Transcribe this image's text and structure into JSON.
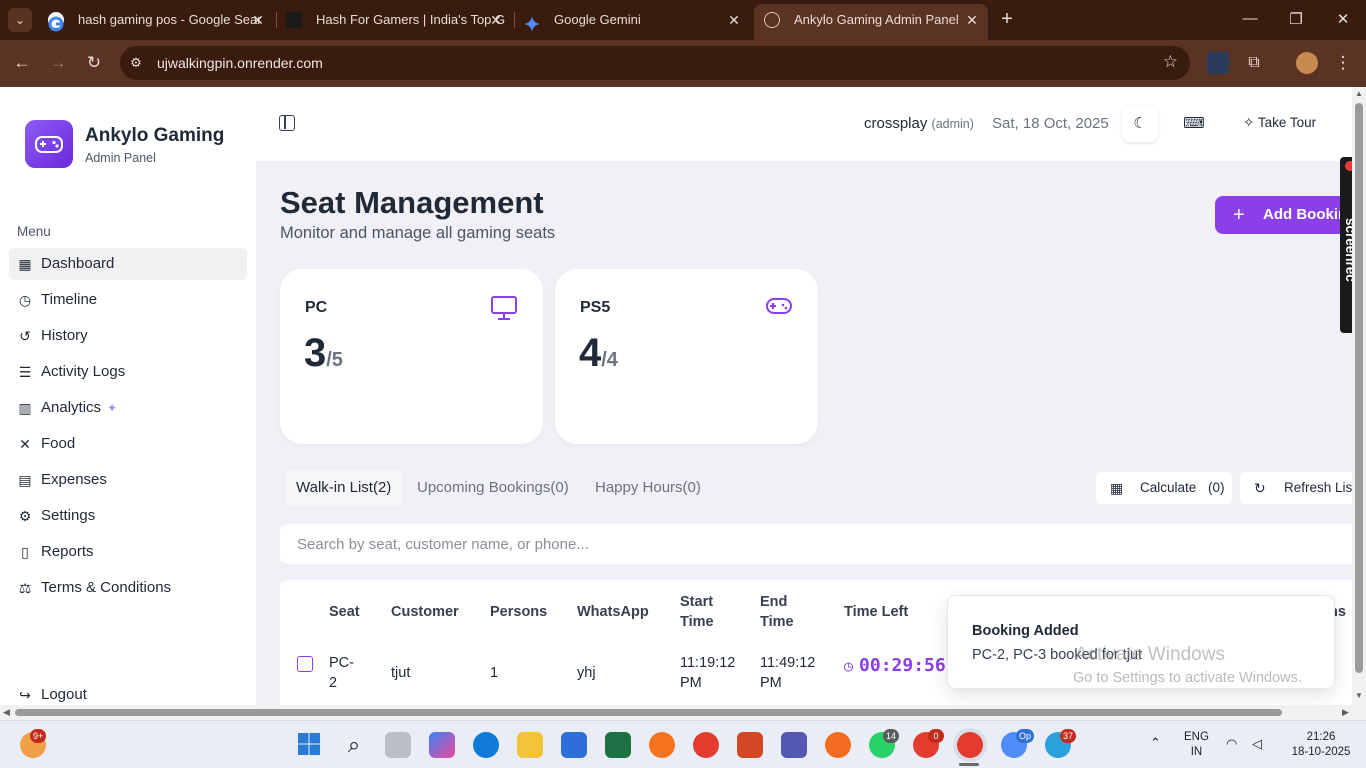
{
  "browser": {
    "tabs": [
      {
        "title": "hash gaming pos - Google Sear",
        "favicon_color": "#ffffff"
      },
      {
        "title": "Hash For Gamers | India's Top G",
        "favicon_color": "#1a1a1a"
      },
      {
        "title": "Google Gemini",
        "favicon_color": "#4f8cf7"
      },
      {
        "title": "Ankylo Gaming Admin Panel",
        "favicon_color": "#cfc4bd"
      }
    ],
    "url": "ujwalkingpin.onrender.com"
  },
  "sidebar": {
    "brand": "Ankylo Gaming",
    "brand_sub": "Admin Panel",
    "menu_title": "Menu",
    "items": [
      {
        "label": "Dashboard",
        "icon": "grid-icon"
      },
      {
        "label": "Timeline",
        "icon": "clock-icon"
      },
      {
        "label": "History",
        "icon": "history-icon"
      },
      {
        "label": "Activity Logs",
        "icon": "clipboard-icon"
      },
      {
        "label": "Analytics",
        "icon": "chart-icon"
      },
      {
        "label": "Food",
        "icon": "utensils-icon"
      },
      {
        "label": "Expenses",
        "icon": "receipt-icon"
      },
      {
        "label": "Settings",
        "icon": "gear-icon"
      },
      {
        "label": "Reports",
        "icon": "file-icon"
      },
      {
        "label": "Terms & Conditions",
        "icon": "scale-icon"
      }
    ],
    "logout": "Logout"
  },
  "topbar": {
    "username": "crossplay",
    "role": "(admin)",
    "date": "Sat, 18 Oct, 2025",
    "tour_label": "Take Tour"
  },
  "page": {
    "title": "Seat Management",
    "subtitle": "Monitor and manage all gaming seats",
    "add_button": "Add Bookin"
  },
  "cards": [
    {
      "title": "PC",
      "count": "3",
      "total": "/5",
      "icon": "monitor-icon"
    },
    {
      "title": "PS5",
      "count": "4",
      "total": "/4",
      "icon": "gamepad-icon"
    }
  ],
  "tabs": [
    {
      "label": "Walk-in List(2)"
    },
    {
      "label": "Upcoming Bookings(0)"
    },
    {
      "label": "Happy Hours(0)"
    }
  ],
  "actions": {
    "calculate": "Calculate",
    "calculate_count": "(0)",
    "refresh": "Refresh List"
  },
  "search": {
    "placeholder": "Search by seat, customer name, or phone..."
  },
  "table": {
    "headers": {
      "seat": "Seat",
      "customer": "Customer",
      "persons": "Persons",
      "whatsapp": "WhatsApp",
      "start_time": "Start\nTime",
      "end_time": "End\nTime",
      "time_left": "Time Left",
      "actions": "ns"
    },
    "rows": [
      {
        "seat": "PC-\n2",
        "customer": "tjut",
        "persons": "1",
        "whatsapp": "yhj",
        "start_time": "11:19:12\nPM",
        "end_time": "11:49:12\nPM",
        "time_left": "00:29:56"
      }
    ]
  },
  "toast": {
    "title": "Booking Added",
    "message": "PC-2, PC-3 booked for tjut"
  },
  "watermark": {
    "line1": "Activate Windows",
    "line2": "Go to Settings to activate Windows."
  },
  "screenrec": "screenrec",
  "taskbar": {
    "weather_badge": "9+",
    "whatsapp_badge": "14",
    "chrome1_badge": "0",
    "chrome3_badge": "Op",
    "telegram_badge": "37",
    "lang_line1": "ENG",
    "lang_line2": "IN",
    "time": "21:26",
    "date": "18-10-2025"
  },
  "colors": {
    "accent": "#8b3fe8",
    "browser_dark": "#3a1c0f",
    "browser_mid": "#5b3322"
  }
}
